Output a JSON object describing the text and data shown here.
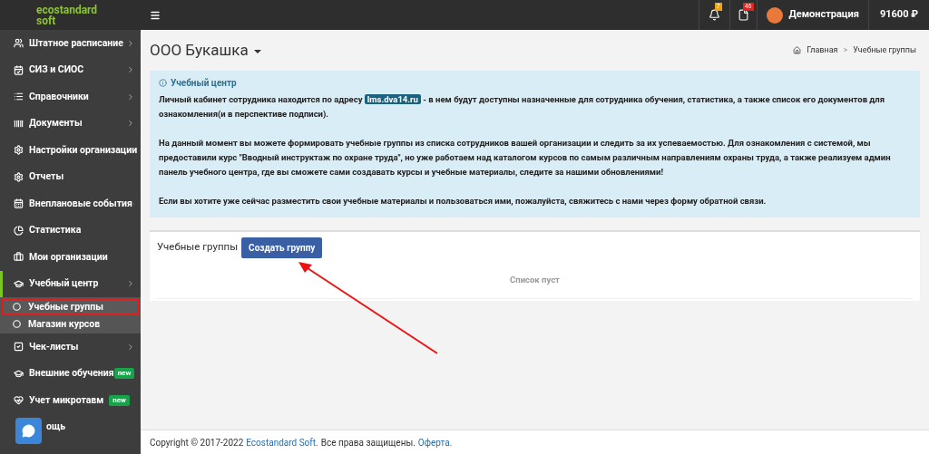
{
  "logo": {
    "line1": "ecostandard",
    "line2": "soft"
  },
  "topbar": {
    "notifications": "7",
    "documents": "46",
    "user": "Демонстрация",
    "balance": "91600 ₽"
  },
  "sidebar": {
    "items": [
      {
        "label": "Штатное расписание",
        "has_submenu": true,
        "selected": false
      },
      {
        "label": "СИЗ и СИОС",
        "has_submenu": true,
        "selected": false
      },
      {
        "label": "Справочники",
        "has_submenu": true,
        "selected": false
      },
      {
        "label": "Документы",
        "has_submenu": true,
        "selected": false
      },
      {
        "label": "Настройки организации",
        "has_submenu": false,
        "selected": false
      },
      {
        "label": "Отчеты",
        "has_submenu": false,
        "selected": false
      },
      {
        "label": "Внеплановые события",
        "has_submenu": true,
        "selected": false
      },
      {
        "label": "Статистика",
        "has_submenu": false,
        "selected": false
      },
      {
        "label": "Мои организации",
        "has_submenu": false,
        "selected": false
      },
      {
        "label": "Учебный центр",
        "has_submenu": true,
        "selected": true,
        "children": [
          {
            "label": "Учебные группы",
            "selected": true
          },
          {
            "label": "Магазин курсов",
            "selected": false
          }
        ]
      },
      {
        "label": "Чек-листы",
        "has_submenu": true,
        "selected": false
      },
      {
        "label": "Внешние обучения",
        "has_submenu": false,
        "selected": false,
        "badge": "new"
      },
      {
        "label": "Учет микротавм",
        "has_submenu": false,
        "selected": false,
        "badge": "new"
      },
      {
        "label": "ощь",
        "has_submenu": false,
        "selected": false
      }
    ]
  },
  "page": {
    "title": "ООО Букашка",
    "breadcrumbs": [
      "Главная",
      "Учебные группы"
    ],
    "separator": ">"
  },
  "info": {
    "title": "Учебный центр",
    "p1_before": "Личный кабинет сотрудника находится по адресу",
    "p1_link": "lms.dva14.ru",
    "p1_after": "- в нем будут доступны назначенные для сотрудника обучения, статистика, а также список его документов для ознакомления(и в перспективе подписи).",
    "p2": "На данный момент вы можете формировать учебные группы из списка сотрудников вашей организации и следить за их успеваемостью. Для ознакомления с системой, мы предоставили курс \"Вводный инструктаж по охране труда\", но уже работаем над каталогом курсов по самым различным направлениям охраны труда, а также реализуем админ панель учебного центра, где вы сможете сами создавать курсы и учебные материалы, следите за нашими обновлениями!",
    "p3": "Если вы хотите уже сейчас разместить свои учебные материалы и пользоваться ими, пожалуйста, свяжитесь с нами через форму обратной связи."
  },
  "groups": {
    "title": "Учебные группы",
    "button": "Создать группу",
    "empty": "Список пуст"
  },
  "footer": {
    "before": "Copyright © 2017-2022",
    "company": "Ecostandard Soft.",
    "middle": "Все права защищены.",
    "link": "Оферта."
  }
}
